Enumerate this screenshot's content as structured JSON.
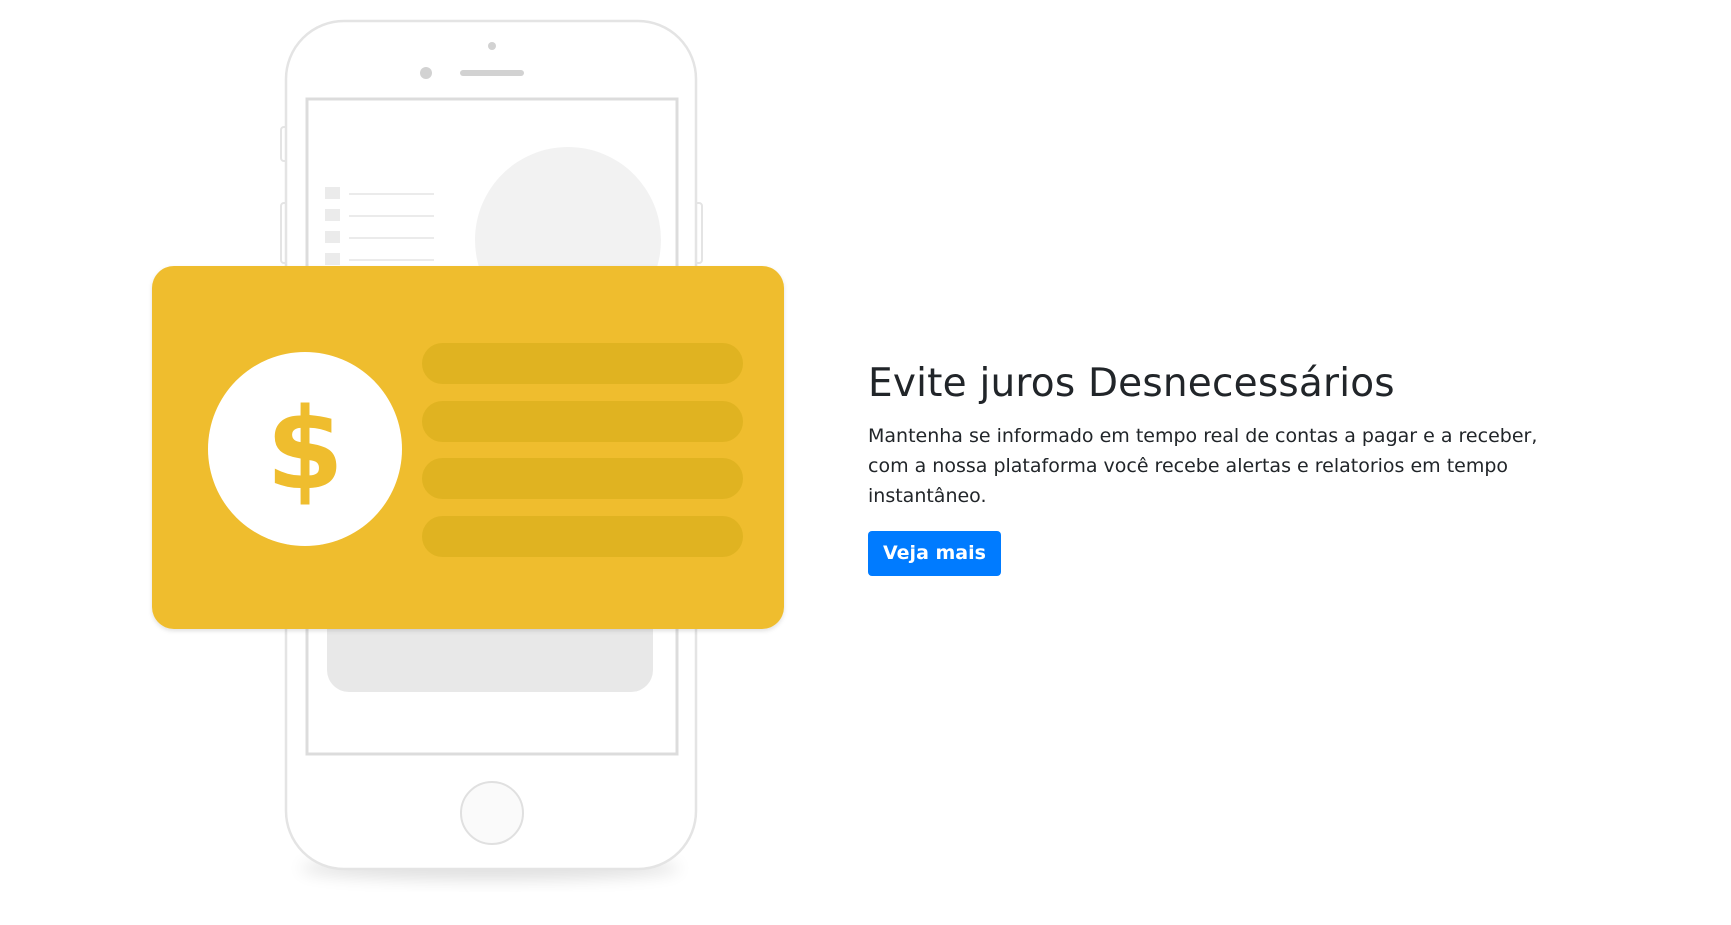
{
  "hero": {
    "title": "Evite juros Desnecessários",
    "description": "Mantenha se informado em tempo real de contas a pagar e a receber, com a nossa plataforma você recebe alertas e relatorios em tempo instantâneo.",
    "button_label": "Veja mais"
  },
  "illustration": {
    "card_icon": "dollar-sign-icon",
    "card_symbol": "$",
    "card_color": "#efbd2e",
    "card_row_color": "#e0b321"
  },
  "colors": {
    "accent": "#007bff",
    "text": "#212529"
  }
}
